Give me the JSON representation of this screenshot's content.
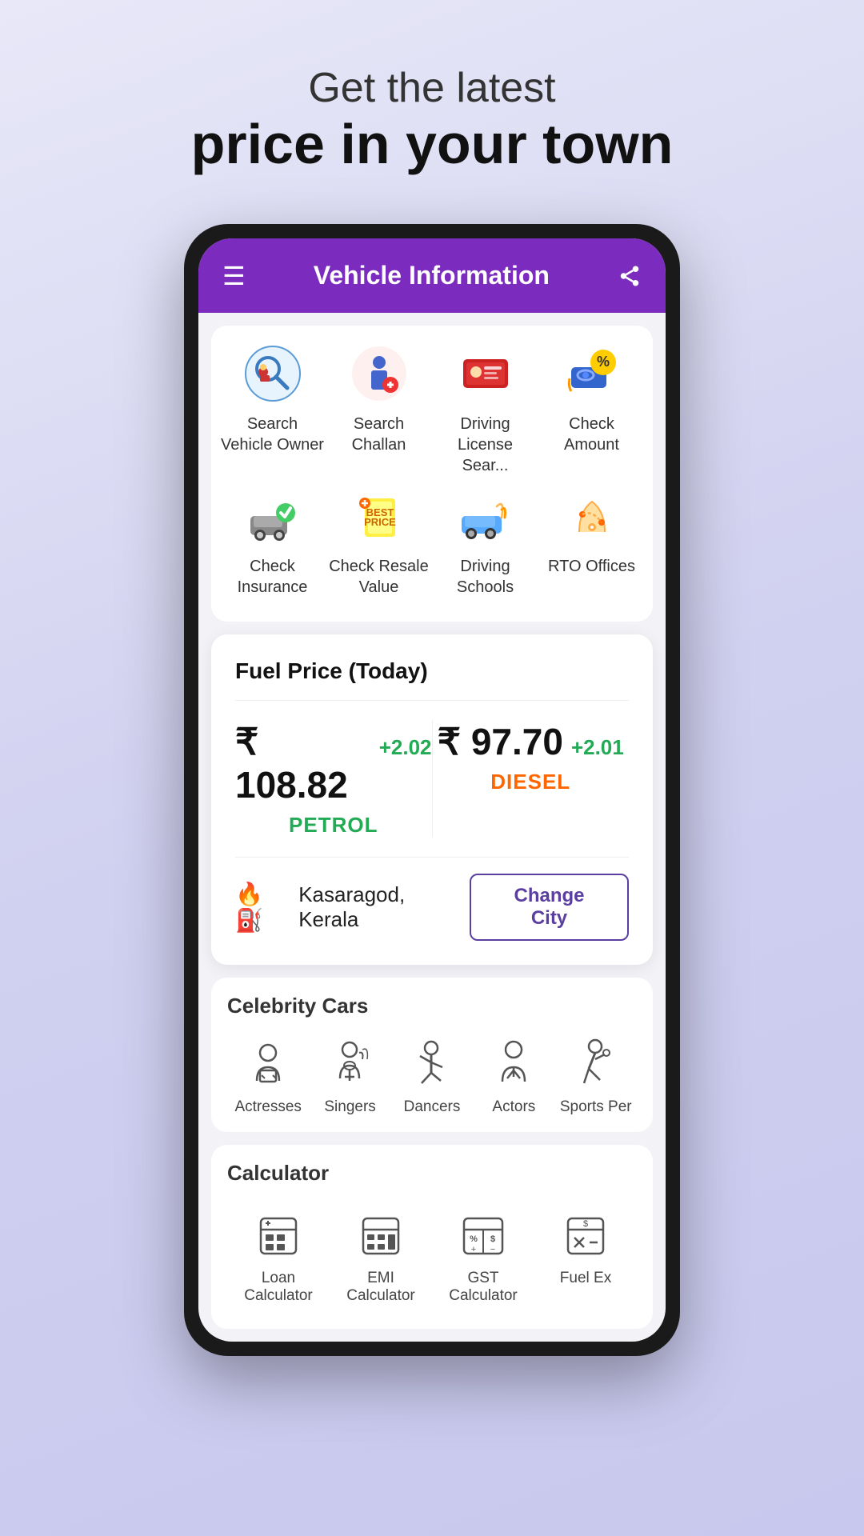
{
  "headline": {
    "sub": "Get the latest",
    "main": "price in your town"
  },
  "app": {
    "title": "Vehicle Information"
  },
  "grid": {
    "row1": [
      {
        "id": "search-vehicle-owner",
        "label": "Search Vehicle Owner",
        "icon": "🔍🚗"
      },
      {
        "id": "search-challan",
        "label": "Search Challan",
        "icon": "👮"
      },
      {
        "id": "driving-license",
        "label": "Driving License Sear...",
        "icon": "🪪🚗"
      },
      {
        "id": "check-amount",
        "label": "Check Amount",
        "icon": "🏷️🚗"
      }
    ],
    "row2": [
      {
        "id": "check-insurance",
        "label": "Check Insurance",
        "icon": "🚗✅"
      },
      {
        "id": "check-resale",
        "label": "Check Resale Value",
        "icon": "💰🏷️"
      },
      {
        "id": "driving-schools",
        "label": "Driving Schools",
        "icon": "🚗🏁"
      },
      {
        "id": "rto-offices",
        "label": "RTO Offices",
        "icon": "🗺️"
      }
    ]
  },
  "fuel": {
    "card_title": "Fuel Price (Today)",
    "petrol": {
      "price": "₹ 108.82",
      "change": "+2.02",
      "label": "PETROL"
    },
    "diesel": {
      "price": "₹ 97.70",
      "change": "+2.01",
      "label": "DIESEL"
    },
    "city": "Kasaragod, Kerala",
    "change_city_label": "Change City"
  },
  "celebrity": {
    "section_title": "Celebrity Cars",
    "items": [
      {
        "id": "actresses",
        "label": "Actresses"
      },
      {
        "id": "singers",
        "label": "Singers"
      },
      {
        "id": "dancers",
        "label": "Dancers"
      },
      {
        "id": "actors",
        "label": "Actors"
      },
      {
        "id": "sports-persons",
        "label": "Sports Per"
      }
    ]
  },
  "calculator": {
    "section_title": "Calculator",
    "items": [
      {
        "id": "loan-calculator",
        "label": "Loan Calculator"
      },
      {
        "id": "emi-calculator",
        "label": "EMI Calculator"
      },
      {
        "id": "gst-calculator",
        "label": "GST Calculator"
      },
      {
        "id": "fuel-ex",
        "label": "Fuel Ex"
      }
    ]
  }
}
